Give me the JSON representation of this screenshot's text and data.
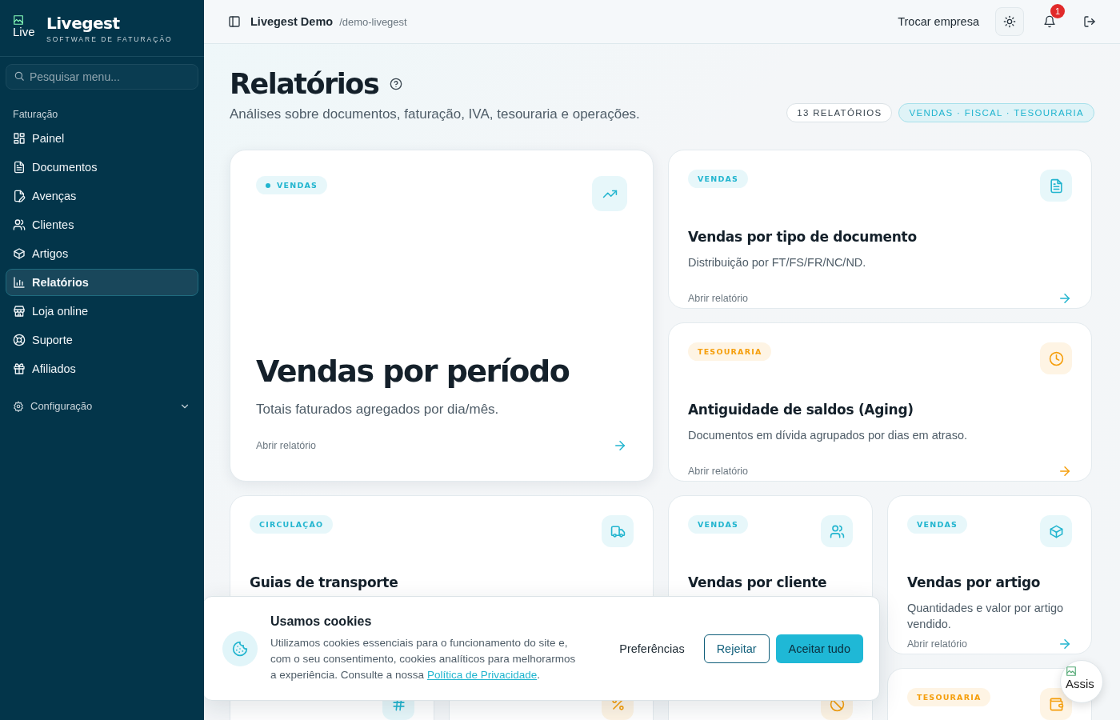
{
  "sidebar": {
    "logo": {
      "image_alt": "Live",
      "name": "Livegest",
      "tagline": "SOFTWARE DE FATURAÇÃO"
    },
    "search": {
      "placeholder": "Pesquisar menu..."
    },
    "section": "Faturação",
    "items": [
      {
        "label": "Painel",
        "selected": false
      },
      {
        "label": "Documentos",
        "selected": false
      },
      {
        "label": "Avenças",
        "selected": false
      },
      {
        "label": "Clientes",
        "selected": false
      },
      {
        "label": "Artigos",
        "selected": false
      },
      {
        "label": "Relatórios",
        "selected": true
      },
      {
        "label": "Loja online",
        "selected": false
      },
      {
        "label": "Suporte",
        "selected": false
      },
      {
        "label": "Afiliados",
        "selected": false
      }
    ],
    "settings": {
      "label": "Configuração",
      "expanded": false
    }
  },
  "header": {
    "company": "Livegest Demo",
    "slug": "/demo-livegest",
    "switch_company": "Trocar empresa",
    "notifications": "1"
  },
  "page": {
    "title": "Relatórios",
    "subtitle": "Análises sobre documentos, faturação, IVA, tesouraria e operações.",
    "count": "13 RELATÓRIOS",
    "categories": "VENDAS · FISCAL · TESOURARIA"
  },
  "cards": [
    {
      "kind": "hero",
      "tag": "VENDAS",
      "color": "#22b5cf",
      "title": "Vendas por período",
      "description": "Totais faturados agregados por dia/mês.",
      "link": "Abrir relatório"
    },
    {
      "kind": "wide",
      "tag": "VENDAS",
      "color": "#22b5cf",
      "title": "Vendas por tipo de documento",
      "description": "Distribuição por FT/FS/FR/NC/ND.",
      "link": "Abrir relatório"
    },
    {
      "kind": "wide",
      "tag": "TESOURARIA",
      "color": "#f59e0b",
      "title": "Antiguidade de saldos (Aging)",
      "description": "Documentos em dívida agrupados por dias em atraso.",
      "link": "Abrir relatório"
    },
    {
      "kind": "wide",
      "tag": "CIRCULAÇÃO",
      "color": "#22b5cf",
      "title": "Guias de transporte"
    },
    {
      "kind": "small",
      "tag": "VENDAS",
      "color": "#22b5cf",
      "title": "Vendas por cliente"
    },
    {
      "kind": "small",
      "tag": "VENDAS",
      "color": "#22b5cf",
      "title": "Vendas por artigo",
      "description": "Quantidades e valor por artigo vendido.",
      "link": "Abrir relatório"
    },
    {
      "kind": "small",
      "color": "#22b5cf"
    },
    {
      "kind": "small",
      "color": "#f59e0b"
    },
    {
      "kind": "small",
      "color": "#f59e0b"
    },
    {
      "kind": "small",
      "tag": "TESOURARIA",
      "color": "#f59e0b"
    }
  ],
  "cookie_banner": {
    "title": "Usamos cookies",
    "text": "Utilizamos cookies essenciais para o funcionamento do site e, com o seu consentimento, cookies analíticos para melhorarmos a experiência. Consulte a nossa",
    "link": "Política de Privacidade",
    "text_end": ".",
    "buttons": [
      {
        "label": "Preferências",
        "kind": "plain"
      },
      {
        "label": "Rejeitar",
        "kind": "outline"
      },
      {
        "label": "Aceitar tudo",
        "kind": "primary"
      }
    ]
  },
  "assistant": {
    "image_alt": "Assis"
  }
}
